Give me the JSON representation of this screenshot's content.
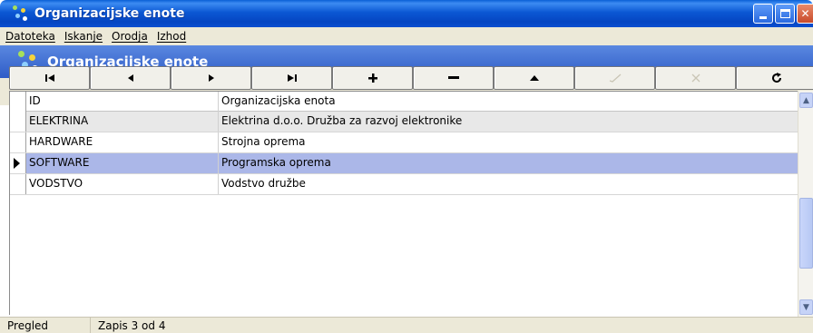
{
  "window": {
    "title": "Organizacijske enote",
    "controls": [
      "minimize-icon",
      "maximize-icon",
      "close-icon"
    ]
  },
  "menu": {
    "items": [
      {
        "label": "Datoteka"
      },
      {
        "label": "Iskanje"
      },
      {
        "label": "Orodja"
      },
      {
        "label": "Izhod"
      }
    ]
  },
  "header": {
    "title": "Organizacijske enote",
    "icon": "org-units-icon"
  },
  "navigator": {
    "buttons": [
      {
        "name": "first-record-button",
        "icon": "first-icon",
        "enabled": true
      },
      {
        "name": "prior-record-button",
        "icon": "prior-icon",
        "enabled": true
      },
      {
        "name": "next-record-button",
        "icon": "next-icon",
        "enabled": true
      },
      {
        "name": "last-record-button",
        "icon": "last-icon",
        "enabled": true
      },
      {
        "name": "insert-record-button",
        "icon": "plus-icon",
        "enabled": true
      },
      {
        "name": "delete-record-button",
        "icon": "minus-icon",
        "enabled": true
      },
      {
        "name": "edit-record-button",
        "icon": "up-triangle-icon",
        "enabled": true
      },
      {
        "name": "post-record-button",
        "icon": "check-icon",
        "enabled": false
      },
      {
        "name": "cancel-record-button",
        "icon": "cancel-icon",
        "enabled": false
      },
      {
        "name": "refresh-button",
        "icon": "refresh-icon",
        "enabled": true
      }
    ]
  },
  "grid": {
    "columns": [
      {
        "label": "ID"
      },
      {
        "label": "Organizacijska enota"
      }
    ],
    "rows": [
      {
        "id": "ELEKTRINA",
        "name": "Elektrina d.o.o. Družba za razvoj elektronike",
        "state": "alt"
      },
      {
        "id": "HARDWARE",
        "name": "Strojna oprema",
        "state": "normal"
      },
      {
        "id": "SOFTWARE",
        "name": "Programska oprema",
        "state": "selected"
      },
      {
        "id": "VODSTVO",
        "name": "Vodstvo družbe",
        "state": "normal"
      }
    ]
  },
  "status": {
    "mode": "Pregled",
    "record": "Zapis 3 od 4"
  },
  "colors": {
    "titlebar": "#0a52d0",
    "band": "#3e6cd3",
    "selected_row": "#abb7e8",
    "alt_row": "#e8e8e8"
  }
}
